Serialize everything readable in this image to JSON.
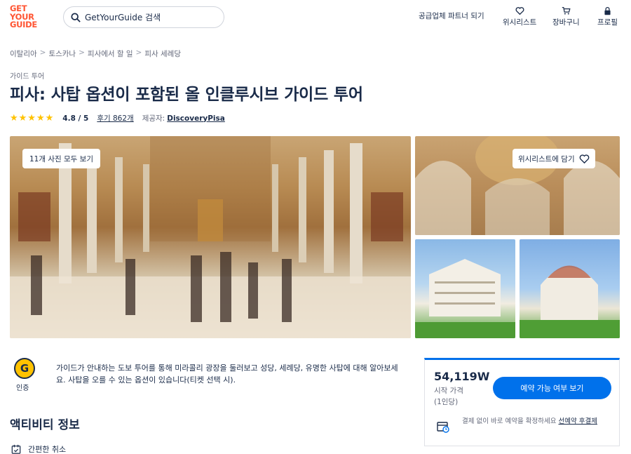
{
  "header": {
    "logo_lines": [
      "GET",
      "YOUR",
      "GUIDE"
    ],
    "search_text": "GetYourGuide 검색",
    "supplier_link": "공급업체 파트너 되기",
    "wishlist_label": "위시리스트",
    "cart_label": "장바구니",
    "profile_label": "프로필"
  },
  "breadcrumb": [
    "이탈리아",
    "토스카나",
    "피사에서 할 일",
    "피사 세례당"
  ],
  "breadcrumb_separator": ">",
  "category": "가이드 투어",
  "title": "피사: 사탑 옵션이 포함된 올 인클루시브 가이드 투어",
  "rating": {
    "stars": "★★★★★",
    "value": "4.8 / 5",
    "reviews": "후기 862개",
    "provider_label": "제공자:",
    "provider": "DiscoveryPisa"
  },
  "gallery": {
    "all_photos": "11개 사진 모두 보기",
    "add_wishlist": "위시리스트에 담기"
  },
  "badge": {
    "symbol": "G",
    "label": "인증"
  },
  "description": "가이드가 안내하는 도보 투어를 통해 미라콜리 광장을 둘러보고 성당, 세례당, 유명한 사탑에 대해 알아보세요. 사탑을 오를 수 있는 옵션이 있습니다(티켓 선택 시).",
  "section_title": "액티비티 정보",
  "features": [
    "간편한 취소"
  ],
  "booking": {
    "price": "54,119W",
    "price_label": "시작 가격",
    "per_person": "(1인당)",
    "cta": "예약 가능 여부 보기",
    "reserve_text": "결제 없이 바로 예약을 확정하세요",
    "reserve_link": "선예약 후결제"
  },
  "colors": {
    "brand": "#ff5533",
    "accent": "#0071eb",
    "star": "#ffc200",
    "text": "#1a2b49"
  }
}
